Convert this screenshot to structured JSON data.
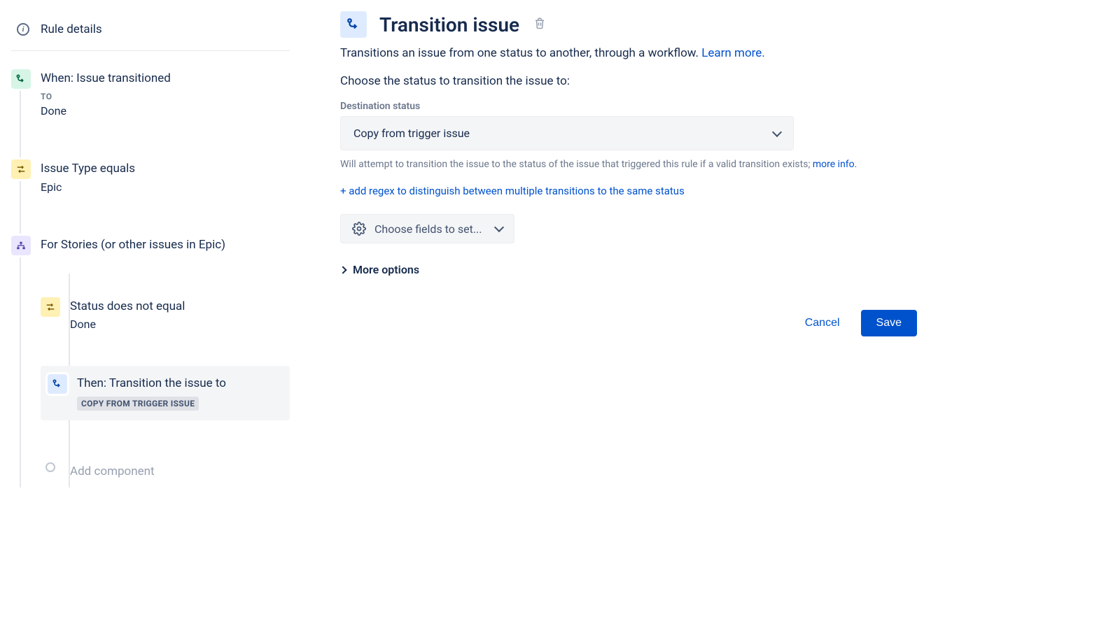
{
  "sidebar": {
    "header": "Rule details",
    "steps": [
      {
        "title": "When: Issue transitioned",
        "subLabel": "TO",
        "value": "Done"
      },
      {
        "title": "Issue Type equals",
        "value": "Epic"
      },
      {
        "title": "For Stories (or other issues in Epic)"
      }
    ],
    "nested": [
      {
        "title": "Status does not equal",
        "value": "Done"
      },
      {
        "title": "Then: Transition the issue to",
        "chip": "COPY FROM TRIGGER ISSUE"
      }
    ],
    "addComponent": "Add component"
  },
  "main": {
    "title": "Transition issue",
    "description": "Transitions an issue from one status to another, through a workflow. ",
    "learnMore": "Learn more.",
    "prompt": "Choose the status to transition the issue to:",
    "destLabel": "Destination status",
    "destValue": "Copy from trigger issue",
    "helper": "Will attempt to transition the issue to the status of the issue that triggered this rule if a valid transition exists; ",
    "moreInfo": "more info.",
    "addRegex": "+ add regex to distinguish between multiple transitions to the same status",
    "fieldsBtn": "Choose fields to set...",
    "moreOptions": "More options",
    "cancel": "Cancel",
    "save": "Save"
  }
}
